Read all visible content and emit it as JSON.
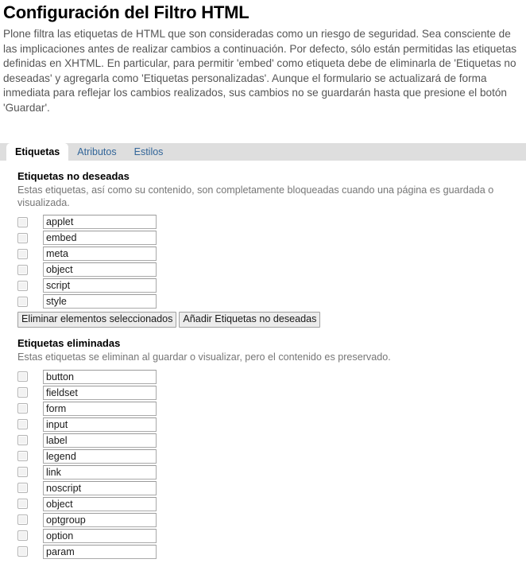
{
  "header": {
    "title": "Configuración del Filtro HTML",
    "intro": "Plone filtra las etiquetas de HTML que son consideradas como un riesgo de seguridad. Sea consciente de las implicaciones antes de realizar cambios a continuación. Por defecto, sólo están permitidas las etiquetas definidas en XHTML. En particular, para permitir 'embed' como etiqueta debe de eliminarla de 'Etiquetas no deseadas' y agregarla como 'Etiquetas personalizadas'. Aunque el formulario se actualizará de forma inmediata para reflejar los cambios realizados, sus cambios no se guardarán hasta que presione el botón 'Guardar'."
  },
  "tabs": [
    {
      "label": "Etiquetas",
      "active": true
    },
    {
      "label": "Atributos",
      "active": false
    },
    {
      "label": "Estilos",
      "active": false
    }
  ],
  "sections": [
    {
      "title": "Etiquetas no deseadas",
      "description": "Estas etiquetas, así como su contenido, son completamente bloqueadas cuando una página es guardada o visualizada.",
      "items": [
        "applet",
        "embed",
        "meta",
        "object",
        "script",
        "style"
      ],
      "buttons": [
        "Eliminar elementos seleccionados",
        "Añadir Etiquetas no deseadas"
      ]
    },
    {
      "title": "Etiquetas eliminadas",
      "description": "Estas etiquetas se eliminan al guardar o visualizar, pero el contenido es preservado.",
      "items": [
        "button",
        "fieldset",
        "form",
        "input",
        "label",
        "legend",
        "link",
        "noscript",
        "object",
        "optgroup",
        "option",
        "param"
      ],
      "buttons": []
    }
  ],
  "colors": {
    "tab_bar_background": "#dedede",
    "link": "#336699",
    "description_text": "#767676",
    "page_background": "#ffffff"
  }
}
